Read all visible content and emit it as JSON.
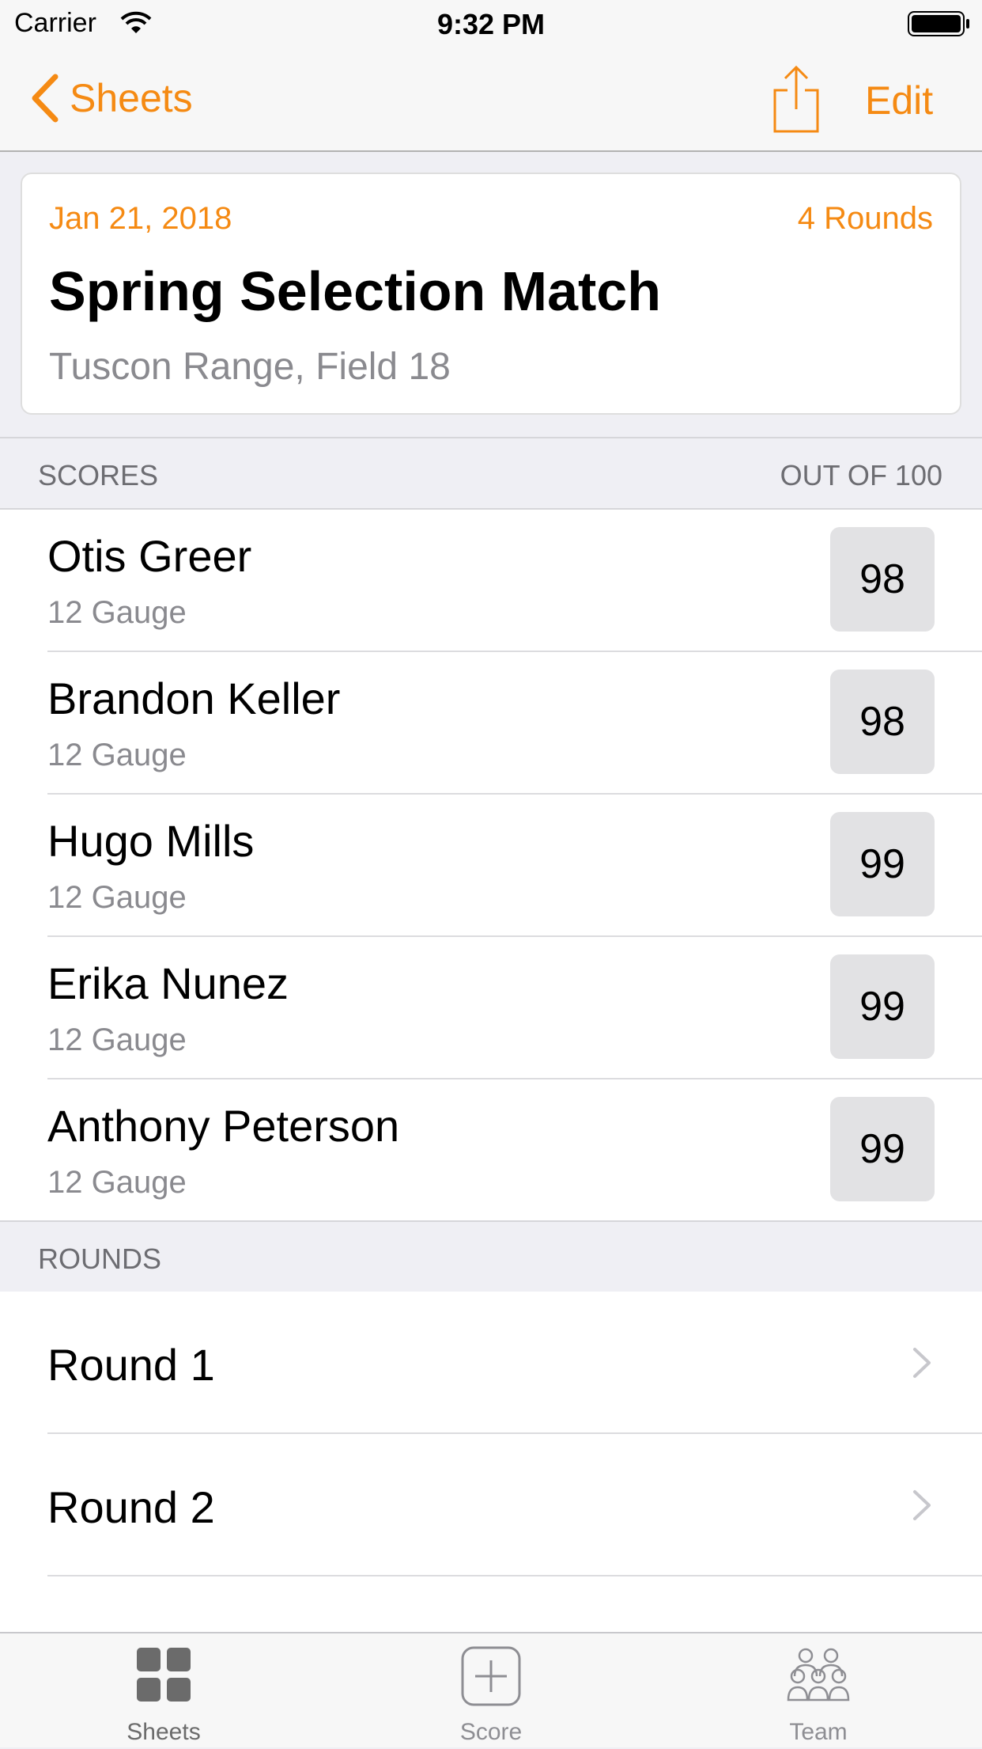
{
  "status_bar": {
    "carrier": "Carrier",
    "time": "9:32 PM"
  },
  "nav": {
    "back_label": "Sheets",
    "edit_label": "Edit",
    "share_icon": "share-icon",
    "accent_color": "#f58a13"
  },
  "sheet": {
    "date": "Jan 21, 2018",
    "rounds_count": "4 Rounds",
    "title": "Spring Selection Match",
    "location": "Tuscon Range, Field 18"
  },
  "scores_section": {
    "header": "SCORES",
    "header_right": "OUT OF 100",
    "rows": [
      {
        "name": "Otis Greer",
        "gauge": "12 Gauge",
        "score": "98"
      },
      {
        "name": "Brandon Keller",
        "gauge": "12 Gauge",
        "score": "98"
      },
      {
        "name": "Hugo Mills",
        "gauge": "12 Gauge",
        "score": "99"
      },
      {
        "name": "Erika Nunez",
        "gauge": "12 Gauge",
        "score": "99"
      },
      {
        "name": "Anthony Peterson",
        "gauge": "12 Gauge",
        "score": "99"
      }
    ]
  },
  "rounds_section": {
    "header": "ROUNDS",
    "rows": [
      {
        "label": "Round 1"
      },
      {
        "label": "Round 2"
      }
    ]
  },
  "tab_bar": {
    "tabs": [
      {
        "label": "Sheets",
        "icon": "grid-icon",
        "active": true
      },
      {
        "label": "Score",
        "icon": "plus-square-icon",
        "active": false
      },
      {
        "label": "Team",
        "icon": "team-icon",
        "active": false
      }
    ]
  }
}
